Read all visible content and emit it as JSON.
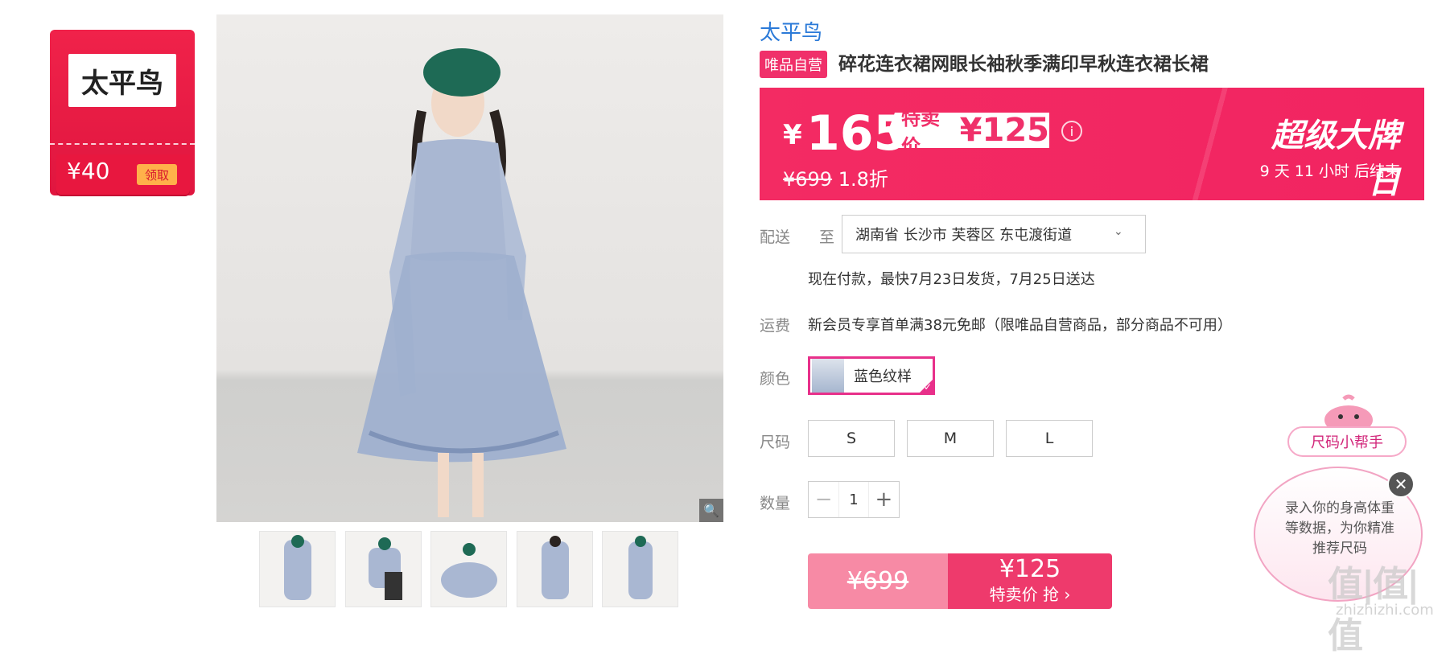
{
  "coupon": {
    "brand": "太平鸟",
    "amount": "¥40",
    "action": "领取"
  },
  "gallery": {
    "thumbnails": [
      "thumb-1",
      "thumb-2",
      "thumb-3",
      "thumb-4",
      "thumb-5"
    ]
  },
  "product": {
    "brand": "太平鸟",
    "badge": "唯品自营",
    "title": "碎花连衣裙网眼长袖秋季满印早秋连衣裙长裙"
  },
  "price": {
    "currency": "¥",
    "current": "165",
    "special_label": "特卖价",
    "special_price": "¥125",
    "original": "¥699",
    "discount": "1.8折",
    "promo_title": "超级大牌日",
    "countdown": "9  天  11  小时 后结束"
  },
  "delivery": {
    "label": "配送",
    "to": "至",
    "address": "湖南省 长沙市 芙蓉区 东屯渡街道",
    "eta": "现在付款，最快7月23日发货，7月25日送达"
  },
  "shipping": {
    "label": "运费",
    "text": "新会员专享首单满38元免邮（限唯品自营商品，部分商品不可用）"
  },
  "color": {
    "label": "颜色",
    "selected": "蓝色纹样"
  },
  "size": {
    "label": "尺码",
    "options": [
      "S",
      "M",
      "L"
    ]
  },
  "quantity": {
    "label": "数量",
    "value": "1",
    "minus": "−",
    "plus": "+"
  },
  "buy": {
    "original": "¥699",
    "price": "¥125",
    "action": "特卖价 抢 ›"
  },
  "helper": {
    "label": "尺码小帮手",
    "text": "录入你的身高体重等数据，为你精准推荐尺码"
  },
  "watermark": {
    "main": "值|值|值",
    "sub": "zhizhizhi.com"
  }
}
